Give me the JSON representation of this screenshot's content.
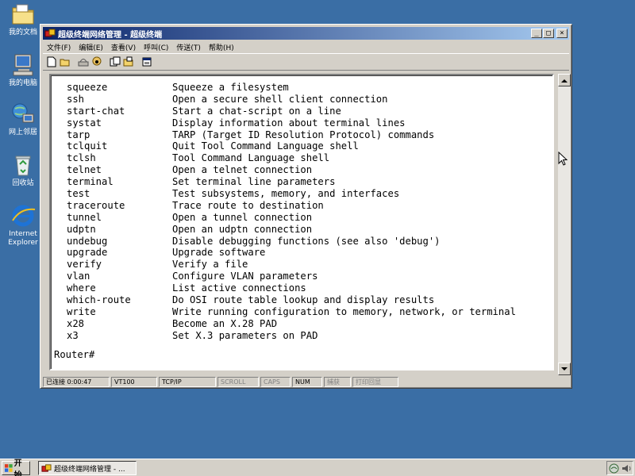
{
  "desktop": {
    "icons": [
      {
        "label": "我的文档",
        "icon": "folder-icon"
      },
      {
        "label": "我的电脑",
        "icon": "computer-icon"
      },
      {
        "label": "网上邻居",
        "icon": "network-icon"
      },
      {
        "label": "回收站",
        "icon": "recycle-bin-icon"
      },
      {
        "label": "Internet\nExplorer",
        "icon": "internet-explorer-icon"
      }
    ]
  },
  "window": {
    "title": "超级终端网络管理 - 超级终端",
    "menu": [
      "文件(F)",
      "编辑(E)",
      "查看(V)",
      "呼叫(C)",
      "传送(T)",
      "帮助(H)"
    ],
    "toolbar": [
      "new-icon",
      "open-icon",
      "disconnect-icon",
      "properties-icon",
      "send-icon",
      "receive-icon",
      "settings-icon"
    ],
    "buttons": {
      "minimize": "_",
      "maximize": "□",
      "close": "×"
    }
  },
  "terminal": {
    "commands": [
      {
        "name": "squeeze",
        "desc": "Squeeze a filesystem"
      },
      {
        "name": "ssh",
        "desc": "Open a secure shell client connection"
      },
      {
        "name": "start-chat",
        "desc": "Start a chat-script on a line"
      },
      {
        "name": "systat",
        "desc": "Display information about terminal lines"
      },
      {
        "name": "tarp",
        "desc": "TARP (Target ID Resolution Protocol) commands"
      },
      {
        "name": "tclquit",
        "desc": "Quit Tool Command Language shell"
      },
      {
        "name": "tclsh",
        "desc": "Tool Command Language shell"
      },
      {
        "name": "telnet",
        "desc": "Open a telnet connection"
      },
      {
        "name": "terminal",
        "desc": "Set terminal line parameters"
      },
      {
        "name": "test",
        "desc": "Test subsystems, memory, and interfaces"
      },
      {
        "name": "traceroute",
        "desc": "Trace route to destination"
      },
      {
        "name": "tunnel",
        "desc": "Open a tunnel connection"
      },
      {
        "name": "udptn",
        "desc": "Open an udptn connection"
      },
      {
        "name": "undebug",
        "desc": "Disable debugging functions (see also 'debug')"
      },
      {
        "name": "upgrade",
        "desc": "Upgrade software"
      },
      {
        "name": "verify",
        "desc": "Verify a file"
      },
      {
        "name": "vlan",
        "desc": "Configure VLAN parameters"
      },
      {
        "name": "where",
        "desc": "List active connections"
      },
      {
        "name": "which-route",
        "desc": "Do OSI route table lookup and display results"
      },
      {
        "name": "write",
        "desc": "Write running configuration to memory, network, or terminal"
      },
      {
        "name": "x28",
        "desc": "Become an X.28 PAD"
      },
      {
        "name": "x3",
        "desc": "Set X.3 parameters on PAD"
      }
    ],
    "prompt": "Router#"
  },
  "statusbar": {
    "connected": "已连接 0:00:47",
    "emulation": "VT100",
    "protocol": "TCP/IP",
    "scroll": "SCROLL",
    "caps": "CAPS",
    "num": "NUM",
    "capture": "捕获",
    "print_echo": "打印回显"
  },
  "taskbar": {
    "start_label": "开始",
    "task_label": "超级终端网络管理 - ..."
  },
  "colors": {
    "desktop": "#3a6ea5",
    "titlebar_start": "#0a246a",
    "titlebar_end": "#a6caf0",
    "chrome": "#d4d0c8"
  }
}
